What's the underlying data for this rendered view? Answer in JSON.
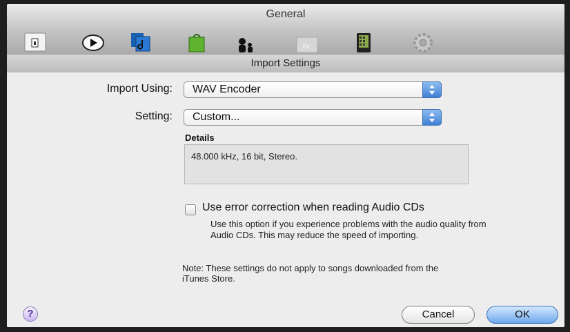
{
  "window": {
    "title": "General"
  },
  "toolbar": {
    "items": [
      {
        "icon": "general-switch-icon"
      },
      {
        "icon": "playback-icon"
      },
      {
        "icon": "sharing-icon"
      },
      {
        "icon": "store-bag-icon"
      },
      {
        "icon": "parental-icon"
      },
      {
        "icon": "apple-tv-icon",
        "label": "tv"
      },
      {
        "icon": "devices-icon"
      },
      {
        "icon": "advanced-gear-icon"
      }
    ]
  },
  "sheet": {
    "title": "Import Settings",
    "import_using_label": "Import Using:",
    "import_using_value": "WAV Encoder",
    "setting_label": "Setting:",
    "setting_value": "Custom...",
    "details_label": "Details",
    "details_text": "48.000 kHz, 16 bit, Stereo.",
    "error_correction_label": "Use error correction when reading Audio CDs",
    "error_correction_checked": false,
    "error_correction_help": "Use this option if you experience problems with the audio quality from Audio CDs. This may reduce the speed of importing.",
    "note": "Note: These settings do not apply to songs downloaded from the iTunes Store.",
    "help_label": "?",
    "cancel_label": "Cancel",
    "ok_label": "OK"
  }
}
